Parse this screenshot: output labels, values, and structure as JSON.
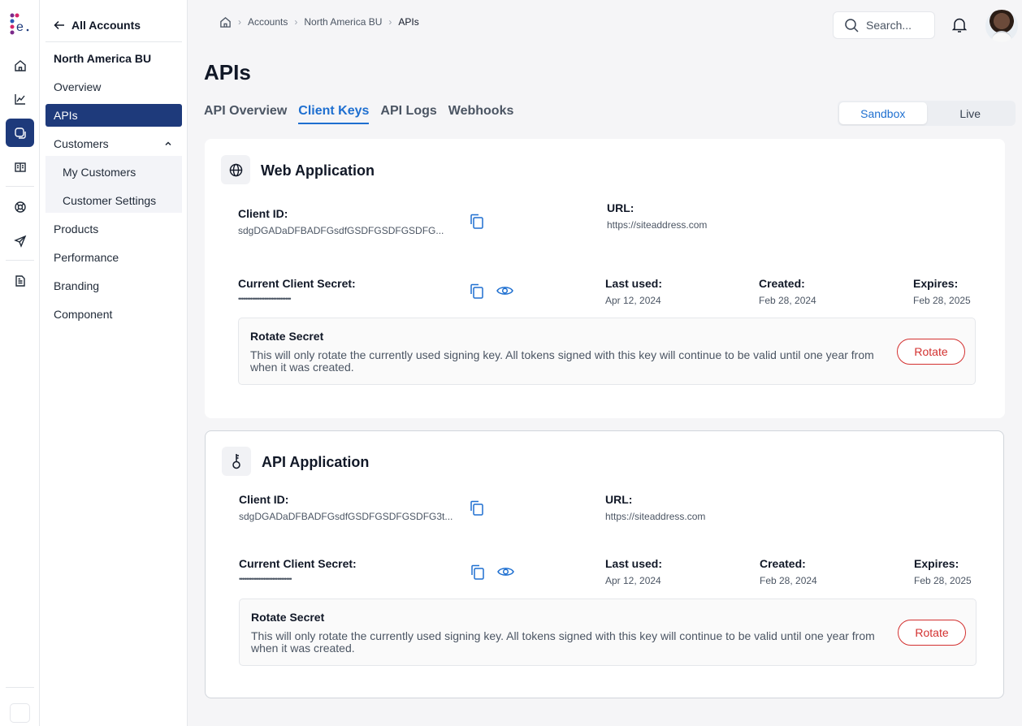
{
  "sidebar": {
    "back_label": "All Accounts",
    "business_unit": "North America BU",
    "items": {
      "overview": "Overview",
      "apis": "APIs",
      "customers": "Customers",
      "my_customers": "My Customers",
      "customer_settings": "Customer Settings",
      "products": "Products",
      "performance": "Performance",
      "branding": "Branding",
      "component": "Component"
    }
  },
  "breadcrumb": [
    "Accounts",
    "North America BU",
    "APIs"
  ],
  "search": {
    "placeholder": "Search..."
  },
  "page": {
    "title": "APIs"
  },
  "tabs": [
    "API Overview",
    "Client Keys",
    "API Logs",
    "Webhooks"
  ],
  "active_tab": "Client Keys",
  "environment": {
    "options": [
      "Sandbox",
      "Live"
    ],
    "selected": "Sandbox"
  },
  "labels": {
    "client_id": "Client ID:",
    "url": "URL:",
    "current_secret": "Current Client Secret:",
    "last_used": "Last used:",
    "created": "Created:",
    "expires": "Expires:",
    "rotate_title": "Rotate Secret",
    "rotate_desc": "This will only rotate the currently used signing key. All tokens signed with this key will continue to be valid until one year from when it was created.",
    "rotate_button": "Rotate"
  },
  "apps": [
    {
      "name": "Web Application",
      "icon": "globe-icon",
      "client_id": "sdgDGADaDFBADFGsdfGSDFGSDFGSDFG...",
      "url": "https://siteaddress.com",
      "secret_mask": "••••••••••••••••••••••••••••••",
      "last_used": "Apr 12, 2024",
      "created": "Feb 28, 2024",
      "expires": "Feb 28, 2025"
    },
    {
      "name": "API Application",
      "icon": "key-icon",
      "client_id": "sdgDGADaDFBADFGsdfGSDFGSDFGSDFG3t...",
      "url": "https://siteaddress.com",
      "secret_mask": "••••••••••••••••••••••••••••••",
      "last_used": "Apr 12, 2024",
      "created": "Feb 28, 2024",
      "expires": "Feb 28, 2025"
    }
  ],
  "colors": {
    "primary": "#1e3a7b",
    "accent": "#1e6fd0",
    "danger": "#d3302f"
  }
}
